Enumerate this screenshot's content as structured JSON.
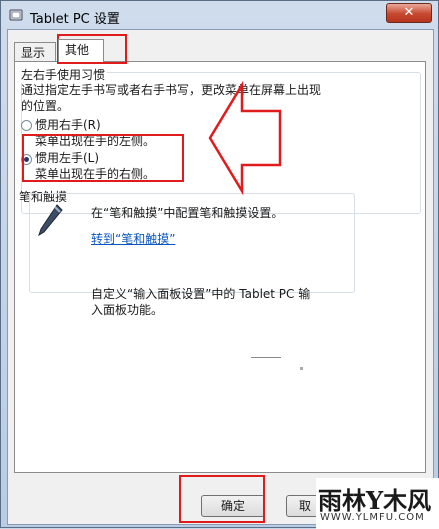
{
  "window": {
    "title": "Tablet PC 设置",
    "close_label": "✕"
  },
  "tabs": [
    {
      "label": "显示"
    },
    {
      "label": "其他"
    }
  ],
  "handedness": {
    "group_label": "左右手使用习惯",
    "description": "通过指定左手书写或者右手书写，更改菜单在屏幕上出现的位置。",
    "desc_line1": "通过指定左手书写或者右手书写，更改菜单在屏幕上出现",
    "desc_line2": "的位置。",
    "right": {
      "label": "惯用右手(R)",
      "desc": "菜单出现在手的左侧。",
      "selected": false
    },
    "left": {
      "label": "惯用左手(L)",
      "desc": "菜单出现在手的右侧。",
      "selected": true
    }
  },
  "pen": {
    "group_label": "笔和触摸",
    "description": "在“笔和触摸”中配置笔和触摸设置。",
    "link": "转到“笔和触摸”"
  },
  "input_panel": {
    "line1": "自定义“输入面板设置”中的 Tablet PC 输",
    "line2": "入面板功能。"
  },
  "buttons": {
    "ok": "确定",
    "cancel": "取"
  },
  "watermark": {
    "main": "雨林Y木风",
    "sub": "WWW.YLMFU.COM"
  },
  "colors": {
    "annotation": "#e01b1b",
    "link": "#0a56c0"
  }
}
